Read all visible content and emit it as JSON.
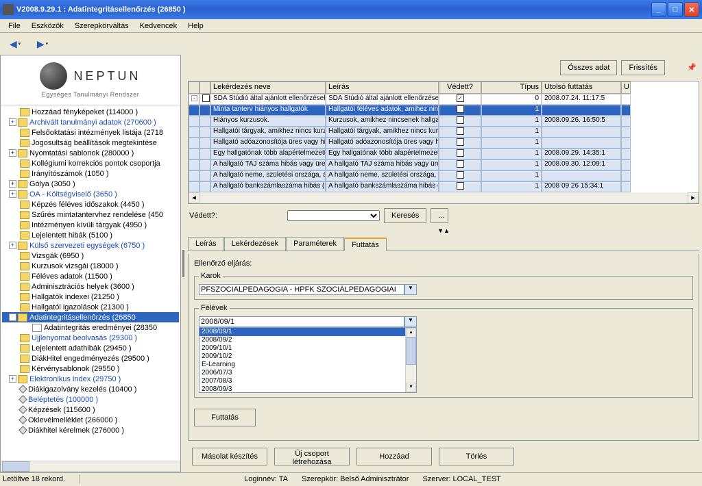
{
  "window": {
    "title": "V2008.9.29.1 : Adatintegritásellenőrzés (26850  )"
  },
  "menu": {
    "file": "File",
    "tools": "Eszközök",
    "roleswitch": "Szerepkörváltás",
    "favorites": "Kedvencek",
    "help": "Help"
  },
  "logo": {
    "name": "NEPTUN",
    "sub": "Egységes Tanulmányi Rendszer"
  },
  "tree": [
    {
      "label": "Hozzáad fényképeket (114000  )",
      "ic": "folder",
      "exp": ""
    },
    {
      "label": "Archivált tanulmányi adatok (270600  )",
      "ic": "folder",
      "exp": "+",
      "link": true
    },
    {
      "label": "Felsőoktatási intézmények listája (2718",
      "ic": "folder",
      "exp": ""
    },
    {
      "label": "Jogosultság beállítások megtekintése",
      "ic": "folder",
      "exp": ""
    },
    {
      "label": "Nyomtatási sablonok (280000  )",
      "ic": "folder",
      "exp": "+"
    },
    {
      "label": "Kollégiumi korrekciós pontok csoportja",
      "ic": "folder",
      "exp": ""
    },
    {
      "label": "Irányítószámok (1050  )",
      "ic": "folder",
      "exp": ""
    },
    {
      "label": "Gólya (3050  )",
      "ic": "folder",
      "exp": "+"
    },
    {
      "label": "OA - Költségviselő (3650  )",
      "ic": "folder",
      "exp": "+",
      "link": true
    },
    {
      "label": "Képzés féléves időszakok (4450  )",
      "ic": "folder",
      "exp": ""
    },
    {
      "label": "Szűrés mintatantervhez rendelése (450",
      "ic": "folder",
      "exp": ""
    },
    {
      "label": "Intézményen kívüli tárgyak (4950  )",
      "ic": "folder",
      "exp": ""
    },
    {
      "label": "Lejelentett hibák (5100  )",
      "ic": "folder",
      "exp": ""
    },
    {
      "label": "Külső szervezeti egységek (6750  )",
      "ic": "folder",
      "exp": "+",
      "link": true
    },
    {
      "label": "Vizsgák (6950  )",
      "ic": "folder",
      "exp": ""
    },
    {
      "label": "Kurzusok vizsgái (18000  )",
      "ic": "folder",
      "exp": ""
    },
    {
      "label": "Féléves adatok (11500  )",
      "ic": "folder",
      "exp": ""
    },
    {
      "label": "Adminisztrációs helyek (3600  )",
      "ic": "folder",
      "exp": ""
    },
    {
      "label": "Hallgatók indexei (21250  )",
      "ic": "folder",
      "exp": ""
    },
    {
      "label": "Hallgatói igazolások (21300  )",
      "ic": "folder",
      "exp": ""
    },
    {
      "label": "Adatintegritásellenőrzés (26850",
      "ic": "folder",
      "exp": "-",
      "sel": true
    },
    {
      "label": "Adatintegritás eredményei (28350",
      "ic": "doc",
      "child": true
    },
    {
      "label": "Ujjlenyomat beolvasás (29300  )",
      "ic": "folder",
      "exp": "",
      "link": true
    },
    {
      "label": "Lejelentett adathibák (29450  )",
      "ic": "folder",
      "exp": ""
    },
    {
      "label": "DiákHitel engedményezés (29500  )",
      "ic": "folder",
      "exp": ""
    },
    {
      "label": "Kérvénysablonok (29550  )",
      "ic": "folder",
      "exp": ""
    },
    {
      "label": "Elektronikus index (29750  )",
      "ic": "folder",
      "exp": "+",
      "link": true
    },
    {
      "label": "Diákigazolvány kezelés (10400  )",
      "ic": "dia"
    },
    {
      "label": "Beléptetés (100000  )",
      "ic": "dia",
      "link": true
    },
    {
      "label": "Képzések (115600  )",
      "ic": "dia"
    },
    {
      "label": "Oklevélmelléklet (266000  )",
      "ic": "dia"
    },
    {
      "label": "Diákhitel kérelmek (276000  )",
      "ic": "dia"
    }
  ],
  "topbuttons": {
    "all": "Összes adat",
    "refresh": "Frissítés"
  },
  "grid": {
    "headers": {
      "c2": "Lekérdezés neve",
      "c3": "Leírás",
      "c4": "Védett?",
      "c5": "Típus",
      "c6": "Utolsó futtatás",
      "c7": "U"
    },
    "rows": [
      {
        "c2": "SDA Stúdió által ajánlott ellenőrzések",
        "c3": "SDA Stúdió által ajánlott ellenőrzések",
        "c4": "✓",
        "c5": "0",
        "c6": "2008.07.24. 11:17:5",
        "group": true
      },
      {
        "c2": "Minta tanterv hiányos hallgatók",
        "c3": "Hallgatói féléves adatok, amihez ninc",
        "c5": "1",
        "sel": true
      },
      {
        "c2": "Hiányos kurzusok.",
        "c3": "Kurzusok, amikhez nincsenek hallgató",
        "c5": "1",
        "c6": "2008.09.26. 16:50:5"
      },
      {
        "c2": "Hallgatói tárgyak, amikhez nincs kurzu",
        "c3": "Hallgatói tárgyak, amikhez nincs kurzu",
        "c5": "1"
      },
      {
        "c2": "Hallgató adóazonosítója üres vagy hib",
        "c3": "Hallgató adóazonosítója üres vagy hib",
        "c5": "1"
      },
      {
        "c2": "Egy hallgatónak több alapértelmezett b",
        "c3": "Egy hallgatónak több alapértelmezett b",
        "c5": "1",
        "c6": "2008.09.29. 14:35:1"
      },
      {
        "c2": "A hallgató TAJ száma hibás vagy üres",
        "c3": "A hallgató TAJ száma hibás vagy üres",
        "c5": "1",
        "c6": "2008.09.30. 12:09:1"
      },
      {
        "c2": "A hallgató neme, születési országa, áll",
        "c3": "A hallgató neme, születési országa, áll",
        "c5": "1"
      },
      {
        "c2": "A hallgató bankszámlaszáma hibás (ha",
        "c3": "A hallgató bankszámlaszáma hibás (ha",
        "c5": "1",
        "c6": "2008 09 26 15:34:1"
      }
    ]
  },
  "filter": {
    "label": "Védett?:",
    "search": "Keresés",
    "more": "..."
  },
  "tabs": {
    "t1": "Leírás",
    "t2": "Lekérdezések",
    "t3": "Paraméterek",
    "t4": "Futtatás"
  },
  "panel": {
    "checklabel": "Ellenőrző eljárás:",
    "karok": {
      "legend": "Karok",
      "value": "PFSZOCIALPEDAGOGIA - HPFK SZOCIÁLPEDAGÓGIAI"
    },
    "felevek": {
      "legend": "Félévek",
      "value": "2008/09/1",
      "options": [
        "2008/09/1",
        "2008/09/2",
        "2009/10/1",
        "2009/10/2",
        "E-Learning",
        "2006/07/3",
        "2007/08/3",
        "2008/09/3"
      ]
    },
    "run": "Futtatás"
  },
  "bottom": {
    "copy": "Másolat készítés",
    "newgroup": "Új csoport létrehozása",
    "add": "Hozzáad",
    "delete": "Törlés"
  },
  "status": {
    "left": "Letöltve 18 rekord.",
    "login": "Loginnév: TA",
    "role": "Szerepkör: Belső Adminisztrátor",
    "server": "Szerver: LOCAL_TEST"
  }
}
